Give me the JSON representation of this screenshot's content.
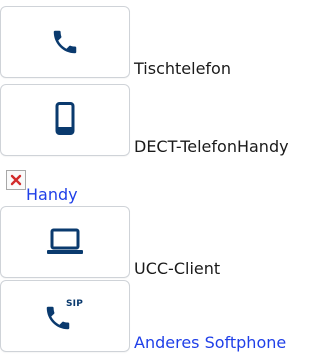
{
  "colors": {
    "icon": "#0a3a6e",
    "link": "#1f3fe8",
    "tile_border": "#cfd3d8",
    "broken_x": "#d22a2a"
  },
  "entries": [
    {
      "icon": "phone-icon",
      "label": "Tischtelefon"
    },
    {
      "icon": "mobile-phone-icon",
      "label": "DECT-TelefonHandy"
    },
    {
      "icon": "broken-image-icon",
      "label": "Handy"
    },
    {
      "icon": "laptop-icon",
      "label": "UCC-Client"
    },
    {
      "icon": "sip-phone-icon",
      "label": "Anderes Softphone",
      "badge": "SIP"
    }
  ]
}
